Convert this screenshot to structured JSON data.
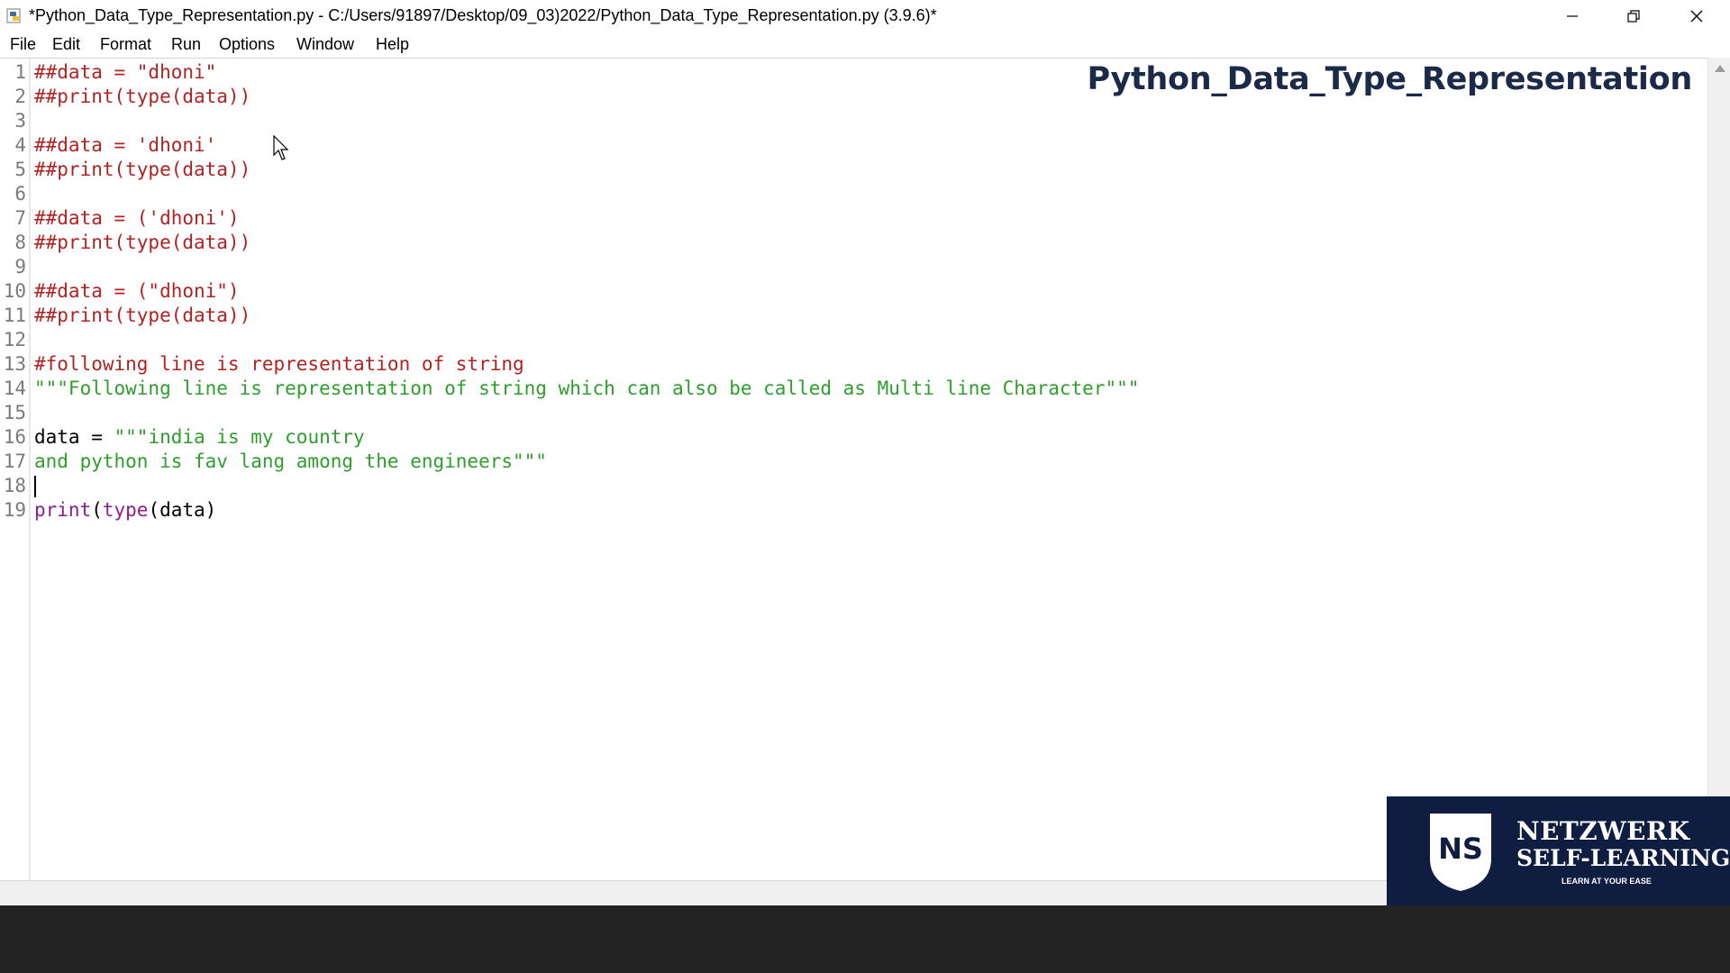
{
  "window": {
    "title": "*Python_Data_Type_Representation.py - C:/Users/91897/Desktop/09_03)2022/Python_Data_Type_Representation.py (3.9.6)*",
    "icons": [
      "python-idle-icon",
      "minimize-icon",
      "restore-icon",
      "close-icon"
    ]
  },
  "menu": [
    "File",
    "Edit",
    "Format",
    "Run",
    "Options",
    "Window",
    "Help"
  ],
  "editor": {
    "line_numbers": [
      "1",
      "2",
      "3",
      "4",
      "5",
      "6",
      "7",
      "8",
      "9",
      "10",
      "11",
      "12",
      "13",
      "14",
      "15",
      "16",
      "17",
      "18",
      "19"
    ],
    "lines": [
      [
        {
          "t": "##data = \"dhoni\"",
          "c": "comment"
        }
      ],
      [
        {
          "t": "##print(type(data))",
          "c": "comment"
        }
      ],
      [],
      [
        {
          "t": "##data = 'dhoni'",
          "c": "comment"
        }
      ],
      [
        {
          "t": "##print(type(data))",
          "c": "comment"
        }
      ],
      [],
      [
        {
          "t": "##data = ('dhoni')",
          "c": "comment"
        }
      ],
      [
        {
          "t": "##print(type(data))",
          "c": "comment"
        }
      ],
      [],
      [
        {
          "t": "##data = (\"dhoni\")",
          "c": "comment"
        }
      ],
      [
        {
          "t": "##print(type(data))",
          "c": "comment"
        }
      ],
      [],
      [
        {
          "t": "#following line is representation of string",
          "c": "comment"
        }
      ],
      [
        {
          "t": "\"\"\"Following line is representation of string which can also be called as Multi line Character\"\"\"",
          "c": "string"
        }
      ],
      [],
      [
        {
          "t": "data = ",
          "c": "normal"
        },
        {
          "t": "\"\"\"india is my country",
          "c": "string"
        }
      ],
      [
        {
          "t": "and python is fav lang among the engineers\"\"\"",
          "c": "string"
        }
      ],
      [],
      [
        {
          "t": "print",
          "c": "builtin"
        },
        {
          "t": "(",
          "c": "normal"
        },
        {
          "t": "type",
          "c": "builtin"
        },
        {
          "t": "(data)",
          "c": "normal"
        }
      ]
    ]
  },
  "overlay_title": "Python_Data_Type_Representation",
  "logo": {
    "initials": "NS",
    "name": "NETZWERK",
    "subtitle": "SELF-LEARNING",
    "tagline": "LEARN AT YOUR EASE"
  },
  "colors": {
    "comment": "#b22222",
    "string": "#2e9e2e",
    "builtin": "#8a1e8a",
    "normal": "#000000",
    "overlay_title": "#1c2a4a",
    "logo_bg": "#0f1e40"
  }
}
